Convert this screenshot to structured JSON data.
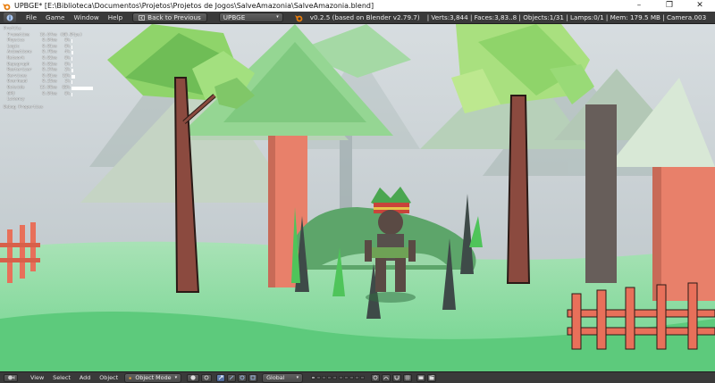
{
  "window": {
    "title": "UPBGE* [E:\\Biblioteca\\Documentos\\Projetos\\Projetos de Jogos\\SalveAmazonia\\SalveAmazonia.blend]",
    "controls": [
      "–",
      "❐",
      "✕"
    ]
  },
  "info_header": {
    "menus": [
      "File",
      "Game",
      "Window",
      "Help"
    ],
    "back_button": "Back to Previous",
    "engine": "UPBGE",
    "version": "v0.2.5 (based on Blender v2.79.7)",
    "stats": "| Verts:3,844 | Faces:3,83..8 | Objects:1/31 | Lamps:0/1 | Mem: 179.5 MB | Camera.003"
  },
  "profile": {
    "title": "Profile",
    "rows": [
      {
        "label": "Frametime",
        "time": "16.67ms",
        "extra": "(60.0fps)",
        "bar": 0
      },
      {
        "label": "Physics",
        "time": "0.04ms",
        "pct": "0%",
        "bar": 0.05
      },
      {
        "label": "Logic",
        "time": "0.01ms",
        "pct": "0%",
        "bar": 0.05
      },
      {
        "label": "Animations",
        "time": "0.70ms",
        "pct": "4%",
        "bar": 0.1
      },
      {
        "label": "Network",
        "time": "0.02ms",
        "pct": "0%",
        "bar": 0.05
      },
      {
        "label": "Depsgraph",
        "time": "0.02ms",
        "pct": "0%",
        "bar": 0.05
      },
      {
        "label": "Rasterizer",
        "time": "0.37ms",
        "pct": "2%",
        "bar": 0.07
      },
      {
        "label": "Services",
        "time": "0.01ms",
        "pct": "10%",
        "bar": 0.18
      },
      {
        "label": "Overhead",
        "time": "0.25ms",
        "pct": "1%",
        "bar": 0.06
      },
      {
        "label": "Outside",
        "time": "13.90ms",
        "pct": "83%",
        "bar": 1
      },
      {
        "label": "GPU Latency",
        "time": "0.04ms",
        "pct": "0%",
        "bar": 0.05
      }
    ],
    "debug_title": "Debug Properties"
  },
  "bottom_header": {
    "menus": [
      "View",
      "Select",
      "Add",
      "Object"
    ],
    "mode": "Object Mode",
    "orientation": "Global"
  },
  "colors": {
    "sky": "#c9d0d3",
    "ground": "#7fd99a",
    "trunk": "#8b4a3f",
    "foliage": "#8fd46a",
    "fence": "#e8705a",
    "orange_trunk": "#e8806a"
  }
}
